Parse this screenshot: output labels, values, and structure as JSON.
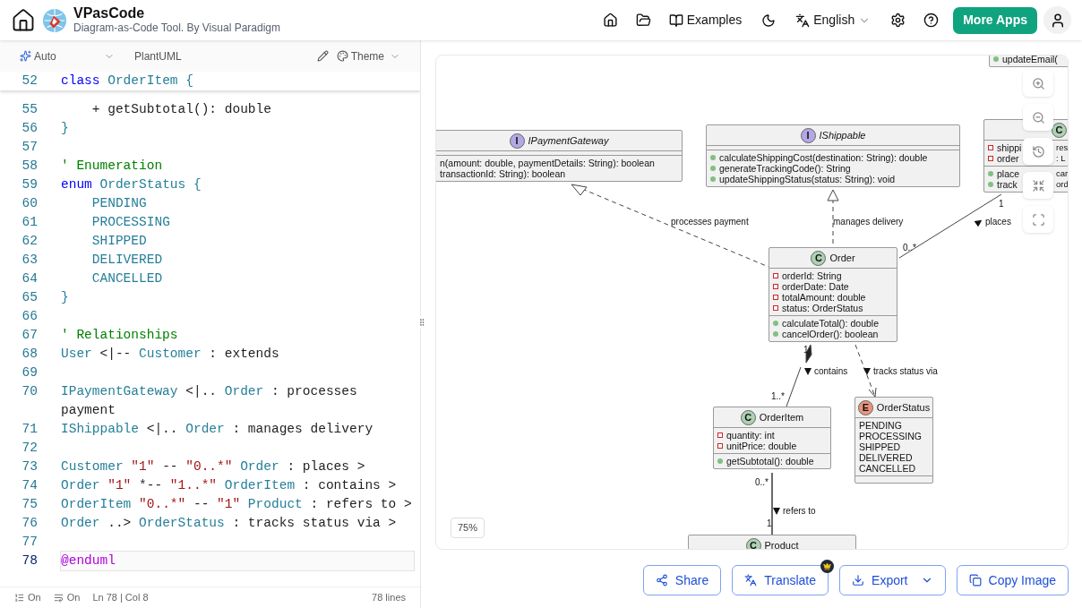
{
  "header": {
    "app_name": "VPasCode",
    "tagline": "Diagram-as-Code Tool. By Visual Paradigm",
    "examples": "Examples",
    "language": "English",
    "more_apps": "More Apps"
  },
  "editor": {
    "mode": "Auto",
    "syntax": "PlantUML",
    "theme": "Theme",
    "sticky": {
      "number": "52",
      "tokens": [
        {
          "kind": "keyword",
          "text": "class"
        },
        {
          "kind": "type",
          "text": " OrderItem {"
        }
      ]
    },
    "lines": [
      {
        "number": "55",
        "selected": false,
        "tokens": [
          {
            "kind": "plain",
            "text": "    + getSubtotal(): double"
          }
        ]
      },
      {
        "number": "56",
        "selected": false,
        "tokens": [
          {
            "kind": "type",
            "text": "}"
          }
        ]
      },
      {
        "number": "57",
        "selected": false
      },
      {
        "number": "58",
        "selected": false,
        "tokens": [
          {
            "kind": "comment",
            "text": "' Enumeration"
          }
        ]
      },
      {
        "number": "59",
        "selected": false,
        "tokens": [
          {
            "kind": "keyword",
            "text": "enum"
          },
          {
            "kind": "type",
            "text": " OrderStatus {"
          }
        ]
      },
      {
        "number": "60",
        "selected": false,
        "tokens": [
          {
            "kind": "type",
            "text": "    PENDING"
          }
        ]
      },
      {
        "number": "61",
        "selected": false,
        "tokens": [
          {
            "kind": "type",
            "text": "    PROCESSING"
          }
        ]
      },
      {
        "number": "62",
        "selected": false,
        "tokens": [
          {
            "kind": "type",
            "text": "    SHIPPED"
          }
        ]
      },
      {
        "number": "63",
        "selected": false,
        "tokens": [
          {
            "kind": "type",
            "text": "    DELIVERED"
          }
        ]
      },
      {
        "number": "64",
        "selected": false,
        "tokens": [
          {
            "kind": "type",
            "text": "    CANCELLED"
          }
        ]
      },
      {
        "number": "65",
        "selected": false,
        "tokens": [
          {
            "kind": "type",
            "text": "}"
          }
        ]
      },
      {
        "number": "66",
        "selected": false
      },
      {
        "number": "67",
        "selected": false,
        "tokens": [
          {
            "kind": "comment",
            "text": "' Relationships"
          }
        ]
      },
      {
        "number": "68",
        "selected": false,
        "tokens": [
          {
            "kind": "type",
            "text": "User"
          },
          {
            "kind": "plain",
            "text": " <|-- "
          },
          {
            "kind": "type",
            "text": "Customer"
          },
          {
            "kind": "plain",
            "text": " : extends"
          }
        ]
      },
      {
        "number": "69",
        "selected": false
      },
      {
        "number": "70",
        "selected": false,
        "tokens": [
          {
            "kind": "type",
            "text": "IPaymentGateway"
          },
          {
            "kind": "plain",
            "text": " <|.. "
          },
          {
            "kind": "type",
            "text": "Order"
          },
          {
            "kind": "plain",
            "text": " : processes payment"
          }
        ]
      },
      {
        "number": "71",
        "selected": false,
        "tokens": [
          {
            "kind": "type",
            "text": "IShippable"
          },
          {
            "kind": "plain",
            "text": " <|.. "
          },
          {
            "kind": "type",
            "text": "Order"
          },
          {
            "kind": "plain",
            "text": " : manages delivery"
          }
        ]
      },
      {
        "number": "72",
        "selected": false
      },
      {
        "number": "73",
        "selected": false,
        "tokens": [
          {
            "kind": "type",
            "text": "Customer"
          },
          {
            "kind": "string",
            "text": " \"1\""
          },
          {
            "kind": "plain",
            "text": " -- "
          },
          {
            "kind": "string",
            "text": "\"0..*\""
          },
          {
            "kind": "type",
            "text": " Order"
          },
          {
            "kind": "plain",
            "text": " : places >"
          }
        ]
      },
      {
        "number": "74",
        "selected": false,
        "tokens": [
          {
            "kind": "type",
            "text": "Order"
          },
          {
            "kind": "string",
            "text": " \"1\""
          },
          {
            "kind": "plain",
            "text": " *-- "
          },
          {
            "kind": "string",
            "text": "\"1..*\""
          },
          {
            "kind": "type",
            "text": " OrderItem"
          },
          {
            "kind": "plain",
            "text": " : contains >"
          }
        ]
      },
      {
        "number": "75",
        "selected": false,
        "tokens": [
          {
            "kind": "type",
            "text": "OrderItem"
          },
          {
            "kind": "string",
            "text": " \"0..*\""
          },
          {
            "kind": "plain",
            "text": " -- "
          },
          {
            "kind": "string",
            "text": "\"1\""
          },
          {
            "kind": "type",
            "text": " Product"
          },
          {
            "kind": "plain",
            "text": " : refers to >"
          }
        ]
      },
      {
        "number": "76",
        "selected": false,
        "tokens": [
          {
            "kind": "type",
            "text": "Order"
          },
          {
            "kind": "plain",
            "text": " ..> "
          },
          {
            "kind": "type",
            "text": "OrderStatus"
          },
          {
            "kind": "plain",
            "text": " : tracks status via >"
          }
        ]
      },
      {
        "number": "77",
        "selected": false
      },
      {
        "number": "78",
        "selected": true,
        "tokens": [
          {
            "kind": "directive",
            "text": "@enduml"
          }
        ]
      }
    ],
    "status": {
      "line_numbers": "On",
      "word_wrap": "On",
      "position": "Ln 78 | Col 8",
      "line_count": "78 lines"
    }
  },
  "diagram": {
    "zoom": "75%",
    "classes": [
      {
        "kind": "fragment",
        "methods": [
          {
            "kind": "public",
            "text": "updateEmail("
          }
        ]
      },
      {
        "kind": "interface",
        "badge": "I",
        "name": "IPaymentGateway",
        "methods": [
          {
            "text": "n(amount: double, paymentDetails: String): boolean"
          },
          {
            "text": "transactionId: String): boolean"
          }
        ]
      },
      {
        "kind": "interface",
        "badge": "I",
        "name": "IShippable",
        "methods": [
          {
            "kind": "public",
            "text": "calculateShippingCost(destination: String): double"
          },
          {
            "kind": "public",
            "text": "generateTrackingCode(): String"
          },
          {
            "kind": "public",
            "text": "updateShippingStatus(status: String): void"
          }
        ]
      },
      {
        "kind": "class",
        "badge": "C",
        "fields": [
          {
            "kind": "private",
            "text": "shippi",
            "tail": "res"
          },
          {
            "kind": "private",
            "text": "order",
            "tail": ": L"
          }
        ],
        "methods": [
          {
            "kind": "public",
            "text": "place",
            "tail": "car"
          },
          {
            "kind": "public",
            "text": "track",
            "tail": "ord"
          }
        ]
      },
      {
        "kind": "class",
        "badge": "C",
        "name": "Order",
        "fields": [
          {
            "kind": "private",
            "text": "orderId: String"
          },
          {
            "kind": "private",
            "text": "orderDate: Date"
          },
          {
            "kind": "private",
            "text": "totalAmount: double"
          },
          {
            "kind": "private",
            "text": "status: OrderStatus"
          }
        ],
        "methods": [
          {
            "kind": "public",
            "text": "calculateTotal(): double"
          },
          {
            "kind": "public",
            "text": "cancelOrder(): boolean"
          }
        ]
      },
      {
        "kind": "class",
        "badge": "C",
        "name": "OrderItem",
        "fields": [
          {
            "kind": "private",
            "text": "quantity: int"
          },
          {
            "kind": "private",
            "text": "unitPrice: double"
          }
        ],
        "methods": [
          {
            "kind": "public",
            "text": "getSubtotal(): double"
          }
        ]
      },
      {
        "kind": "enum",
        "badge": "E",
        "name": "OrderStatus",
        "fields": [
          {
            "text": "PENDING"
          },
          {
            "text": "PROCESSING"
          },
          {
            "text": "SHIPPED"
          },
          {
            "text": "DELIVERED"
          },
          {
            "text": "CANCELLED"
          }
        ]
      },
      {
        "kind": "class",
        "badge": "C",
        "name": "Product"
      }
    ],
    "relations": [
      {
        "text": "processes payment",
        "arrow": false
      },
      {
        "text": "manages delivery",
        "arrow": false
      },
      {
        "text": "places",
        "arrow": true
      },
      {
        "text": "contains",
        "arrow": true
      },
      {
        "text": "tracks status via",
        "arrow": true
      },
      {
        "text": "refers to",
        "arrow": true
      }
    ],
    "multiplicities": [
      "0..*",
      "1",
      "1",
      "1..*",
      "0..*",
      "1"
    ]
  },
  "actions": [
    {
      "kind": "share",
      "label": "Share"
    },
    {
      "kind": "translate",
      "label": "Translate",
      "premium": true
    },
    {
      "kind": "export",
      "label": "Export"
    },
    {
      "kind": "copy",
      "label": "Copy Image"
    }
  ]
}
